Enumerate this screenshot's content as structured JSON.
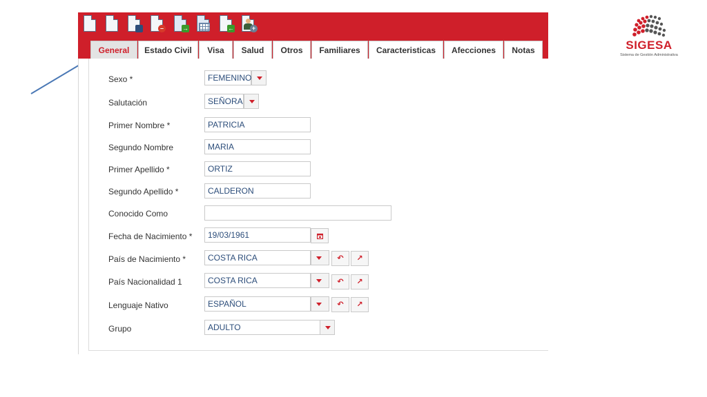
{
  "toolbar": {
    "buttons": [
      {
        "icon": "new-document-icon"
      },
      {
        "icon": "blank-document-icon"
      },
      {
        "icon": "save-document-icon"
      },
      {
        "icon": "delete-document-icon"
      },
      {
        "icon": "export-list-icon"
      },
      {
        "icon": "calendar-list-icon"
      },
      {
        "icon": "import-document-icon"
      },
      {
        "icon": "add-person-icon"
      }
    ]
  },
  "tabs": [
    {
      "label": "General",
      "active": true
    },
    {
      "label": "Estado Civil"
    },
    {
      "label": "Visa"
    },
    {
      "label": "Salud"
    },
    {
      "label": "Otros"
    },
    {
      "label": "Familiares"
    },
    {
      "label": "Caracteristicas"
    },
    {
      "label": "Afecciones"
    },
    {
      "label": "Notas"
    }
  ],
  "form": {
    "sexo": {
      "label": "Sexo *",
      "value": "FEMENINO"
    },
    "salutacion": {
      "label": "Salutación",
      "value": "SEÑORA"
    },
    "primer_nombre": {
      "label": "Primer Nombre *",
      "value": "PATRICIA"
    },
    "segundo_nombre": {
      "label": "Segundo Nombre",
      "value": "MARIA"
    },
    "primer_apellido": {
      "label": "Primer Apellido *",
      "value": "ORTIZ"
    },
    "segundo_apellido": {
      "label": "Segundo Apellido *",
      "value": "CALDERON"
    },
    "conocido_como": {
      "label": "Conocido Como",
      "value": ""
    },
    "fecha_nacimiento": {
      "label": "Fecha de Nacimiento *",
      "value": "19/03/1961"
    },
    "pais_nacimiento": {
      "label": "País de Nacimiento *",
      "value": "COSTA RICA"
    },
    "pais_nacionalidad": {
      "label": "País Nacionalidad 1",
      "value": "COSTA RICA"
    },
    "lenguaje_nativo": {
      "label": "Lenguaje Nativo",
      "value": "ESPAÑOL"
    },
    "grupo": {
      "label": "Grupo",
      "value": "ADULTO"
    }
  },
  "logo": {
    "title": "SIGESA",
    "subtitle": "Sistema de Gestión Administrativa"
  },
  "colors": {
    "brand_red": "#cf1f2a",
    "field_text": "#2c4d7a"
  }
}
